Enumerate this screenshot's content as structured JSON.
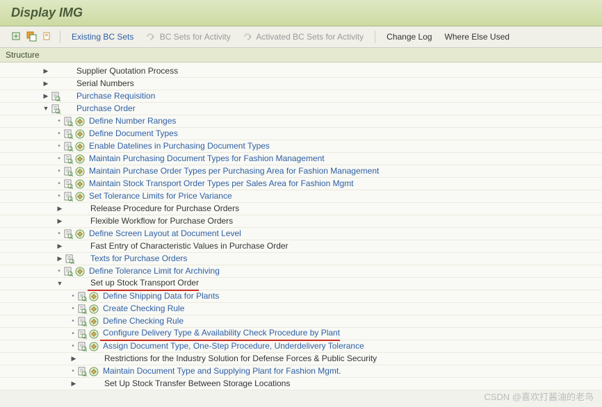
{
  "title": "Display IMG",
  "toolbar": {
    "existing_bc": "Existing BC Sets",
    "bc_activity": "BC Sets for Activity",
    "act_bc_activity": "Activated BC Sets for Activity",
    "change_log": "Change Log",
    "where_used": "Where Else Used"
  },
  "section": "Structure",
  "tree": [
    {
      "lvl": 3,
      "exp": "r",
      "img": 0,
      "exec": 0,
      "text": "Supplier Quotation Process"
    },
    {
      "lvl": 3,
      "exp": "r",
      "img": 0,
      "exec": 0,
      "text": "Serial Numbers"
    },
    {
      "lvl": 3,
      "exp": "r",
      "img": 1,
      "exec": 0,
      "text": "Purchase Requisition"
    },
    {
      "lvl": 3,
      "exp": "d",
      "img": 1,
      "exec": 0,
      "text": "Purchase Order"
    },
    {
      "lvl": 4,
      "exp": "b",
      "img": 1,
      "exec": 1,
      "text": "Define Number Ranges"
    },
    {
      "lvl": 4,
      "exp": "b",
      "img": 1,
      "exec": 1,
      "text": "Define Document Types"
    },
    {
      "lvl": 4,
      "exp": "b",
      "img": 1,
      "exec": 1,
      "text": "Enable Datelines in Purchasing Document Types"
    },
    {
      "lvl": 4,
      "exp": "b",
      "img": 1,
      "exec": 1,
      "text": "Maintain Purchasing Document Types for Fashion Management"
    },
    {
      "lvl": 4,
      "exp": "b",
      "img": 1,
      "exec": 1,
      "text": "Maintain Purchase Order Types per Purchasing Area for Fashion Management"
    },
    {
      "lvl": 4,
      "exp": "b",
      "img": 1,
      "exec": 1,
      "text": "Maintain Stock Transport Order Types per Sales Area for Fashion Mgmt"
    },
    {
      "lvl": 4,
      "exp": "b",
      "img": 1,
      "exec": 1,
      "text": "Set Tolerance Limits for Price Variance"
    },
    {
      "lvl": 4,
      "exp": "r",
      "img": 0,
      "exec": 0,
      "text": "Release Procedure for Purchase Orders"
    },
    {
      "lvl": 4,
      "exp": "r",
      "img": 0,
      "exec": 0,
      "text": "Flexible Workflow for Purchase Orders"
    },
    {
      "lvl": 4,
      "exp": "b",
      "img": 1,
      "exec": 1,
      "text": "Define Screen Layout at Document Level"
    },
    {
      "lvl": 4,
      "exp": "r",
      "img": 0,
      "exec": 0,
      "text": "Fast Entry of Characteristic Values in Purchase Order"
    },
    {
      "lvl": 4,
      "exp": "r",
      "img": 1,
      "exec": 0,
      "text": "Texts for Purchase Orders"
    },
    {
      "lvl": 4,
      "exp": "b",
      "img": 1,
      "exec": 1,
      "text": "Define Tolerance Limit for Archiving"
    },
    {
      "lvl": 4,
      "exp": "d",
      "img": 0,
      "exec": 0,
      "text": "Set up Stock Transport Order",
      "hl": 1
    },
    {
      "lvl": 5,
      "exp": "b",
      "img": 1,
      "exec": 1,
      "text": "Define Shipping Data for Plants"
    },
    {
      "lvl": 5,
      "exp": "b",
      "img": 1,
      "exec": 1,
      "text": "Create Checking Rule"
    },
    {
      "lvl": 5,
      "exp": "b",
      "img": 1,
      "exec": 1,
      "text": "Define Checking Rule"
    },
    {
      "lvl": 5,
      "exp": "b",
      "img": 1,
      "exec": 1,
      "text": "Configure Delivery Type & Availability Check Procedure by Plant",
      "hl": 1
    },
    {
      "lvl": 5,
      "exp": "b",
      "img": 1,
      "exec": 1,
      "text": "Assign Document Type, One-Step Procedure, Underdelivery Tolerance"
    },
    {
      "lvl": 5,
      "exp": "r",
      "img": 0,
      "exec": 0,
      "text": "Restrictions for the Industry Solution for Defense Forces & Public Security"
    },
    {
      "lvl": 5,
      "exp": "b",
      "img": 1,
      "exec": 1,
      "text": "Maintain Document Type and Supplying Plant for Fashion Mgmt."
    },
    {
      "lvl": 5,
      "exp": "r",
      "img": 0,
      "exec": 0,
      "text": "Set Up Stock Transfer Between Storage Locations"
    }
  ],
  "watermark": "CSDN @喜欢打酱油的老鸟"
}
